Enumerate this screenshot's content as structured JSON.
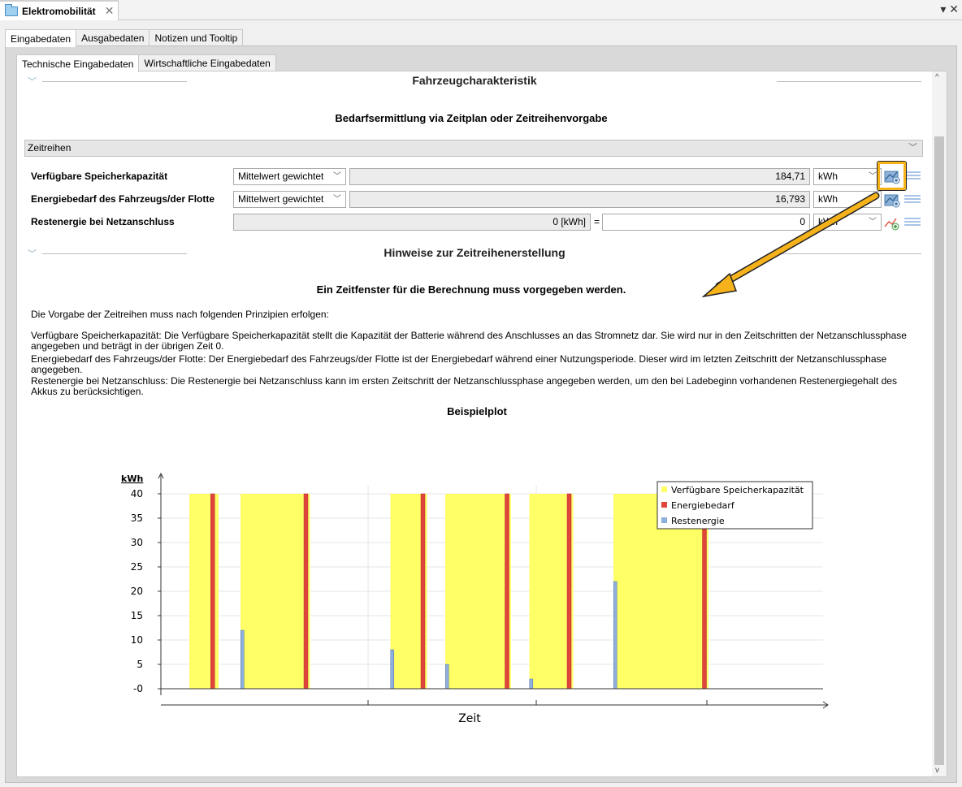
{
  "window": {
    "title": "Elektromobilität",
    "controls": "▾ ✕"
  },
  "tabs": {
    "main": [
      "Eingabedaten",
      "Ausgabedaten",
      "Notizen und Tooltip"
    ],
    "sub": [
      "Technische Eingabedaten",
      "Wirtschaftliche Eingabedaten"
    ]
  },
  "sections": {
    "fahrzeug": "Fahrzeugcharakteristik",
    "bedarf": "Bedarfsermittlung via Zeitplan oder Zeitreihenvorgabe",
    "hinweise": "Hinweise zur Zeitreihenerstellung"
  },
  "mode_select": "Zeitreihen",
  "rows": [
    {
      "label": "Verfügbare Speicherkapazität",
      "method": "Mittelwert gewichtet",
      "value": "184,71",
      "unit": "kWh"
    },
    {
      "label": "Energiebedarf des Fahrzeugs/der Flotte",
      "method": "Mittelwert gewichtet",
      "value": "16,793",
      "unit": "kWh"
    },
    {
      "label": "Restenergie bei Netzanschluss",
      "computed": "0 [kWh]",
      "eq": "=",
      "value": "0",
      "unit": "kWh"
    }
  ],
  "hint": {
    "title": "Ein Zeitfenster für die Berechnung muss vorgegeben werden.",
    "p1": "Die Vorgabe der Zeitreihen muss nach folgenden Prinzipien erfolgen:",
    "p2": "Verfügbare Speicherkapazität: Die Verfügbare Speicherkapazität stellt die Kapazität der Batterie während des Anschlusses an das Stromnetz dar. Sie wird nur in den Zeitschritten der Netzanschlussphase angegeben und beträgt in der übrigen Zeit 0.",
    "p3": "Energiebedarf des Fahrzeugs/der Flotte: Der Energiebedarf des Fahrzeugs/der Flotte ist der Energiebedarf während einer Nutzungsperiode. Dieser wird im letzten Zeitschritt der Netzanschlussphase angegeben.",
    "p4": "Restenergie bei Netzanschluss: Die Restenergie bei Netzanschluss kann im ersten Zeitschritt der Netzanschlussphase angegeben werden, um den bei Ladebeginn vorhandenen Restenergiegehalt des Akkus zu berücksichtigen.",
    "plot_title": "Beispielplot"
  },
  "colors": {
    "capacity": "#ffff66",
    "demand": "#e0453a",
    "rest": "#8fb0dc",
    "highlight": "#f5b21b"
  },
  "chart_data": {
    "type": "bar",
    "ylabel": "kWh",
    "xlabel": "Zeit",
    "ylim": [
      0,
      40
    ],
    "y_ticks": [
      "40",
      "35",
      "30",
      "25",
      "20",
      "15",
      "10",
      "5",
      "-0"
    ],
    "legend_position": "top-right",
    "legend": [
      "Verfügbare Speicherkapazität",
      "Energiebedarf",
      "Restenergie"
    ],
    "series": [
      {
        "name": "Verfügbare Speicherkapazität",
        "windows": [
          [
            0.0,
            0.08
          ],
          [
            0.14,
            0.33
          ],
          [
            0.55,
            0.65
          ],
          [
            0.7,
            0.88
          ],
          [
            0.93,
            1.05
          ],
          [
            1.16,
            1.42
          ]
        ],
        "value": 40
      },
      {
        "name": "Energiebedarf",
        "points": [
          [
            0.065,
            40
          ],
          [
            0.32,
            40
          ],
          [
            0.64,
            40
          ],
          [
            0.87,
            40
          ],
          [
            1.04,
            40
          ],
          [
            1.41,
            40
          ]
        ]
      },
      {
        "name": "Restenergie",
        "points": [
          [
            0.145,
            12
          ],
          [
            0.555,
            8
          ],
          [
            0.705,
            5
          ],
          [
            0.935,
            2
          ],
          [
            1.165,
            22
          ]
        ]
      }
    ]
  }
}
